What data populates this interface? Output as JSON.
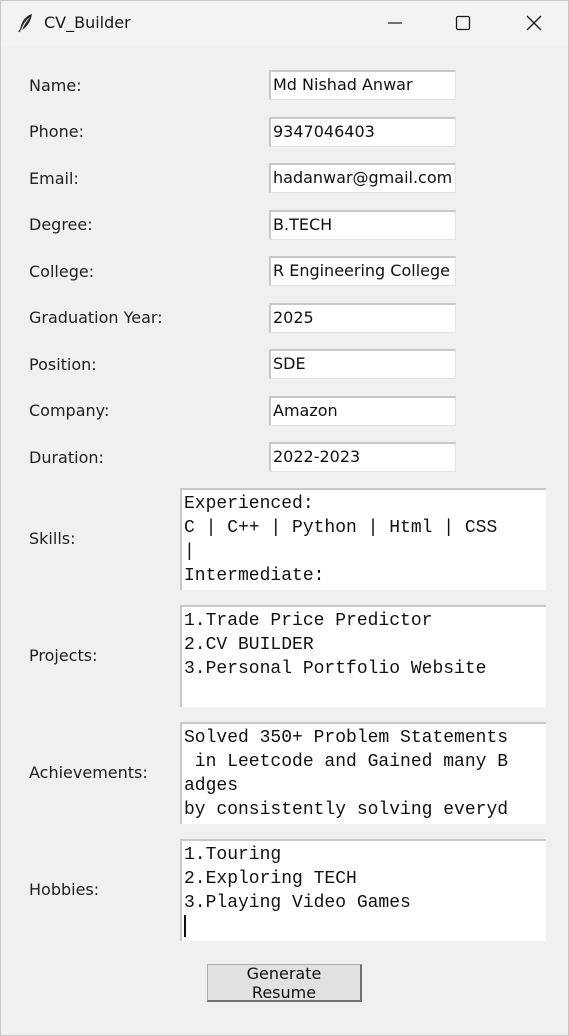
{
  "window": {
    "title": "CV_Builder"
  },
  "fields": [
    {
      "label": "Name:",
      "value": "Md Nishad Anwar"
    },
    {
      "label": "Phone:",
      "value": "9347046403"
    },
    {
      "label": "Email:",
      "value": "hadanwar@gmail.com"
    },
    {
      "label": "Degree:",
      "value": "B.TECH"
    },
    {
      "label": "College:",
      "value": "R Engineering College"
    },
    {
      "label": "Graduation Year:",
      "value": "2025"
    },
    {
      "label": "Position:",
      "value": "SDE"
    },
    {
      "label": "Company:",
      "value": "Amazon"
    },
    {
      "label": "Duration:",
      "value": "2022-2023"
    }
  ],
  "textareas": [
    {
      "label": "Skills:",
      "lines": [
        "Experienced:",
        "C | C++ | Python | Html | CSS",
        "|",
        "Intermediate:"
      ]
    },
    {
      "label": "Projects:",
      "lines": [
        "1.Trade Price Predictor",
        "2.CV BUILDER",
        "3.Personal Portfolio Website"
      ]
    },
    {
      "label": "Achievements:",
      "lines": [
        "Solved 350+ Problem Statements",
        " in Leetcode and Gained many B",
        "adges",
        "by consistently solving everyd"
      ]
    },
    {
      "label": "Hobbies:",
      "lines": [
        "1.Touring",
        "2.Exploring TECH",
        "3.Playing Video Games"
      ]
    }
  ],
  "generate_button": {
    "label": "Generate Resume"
  }
}
